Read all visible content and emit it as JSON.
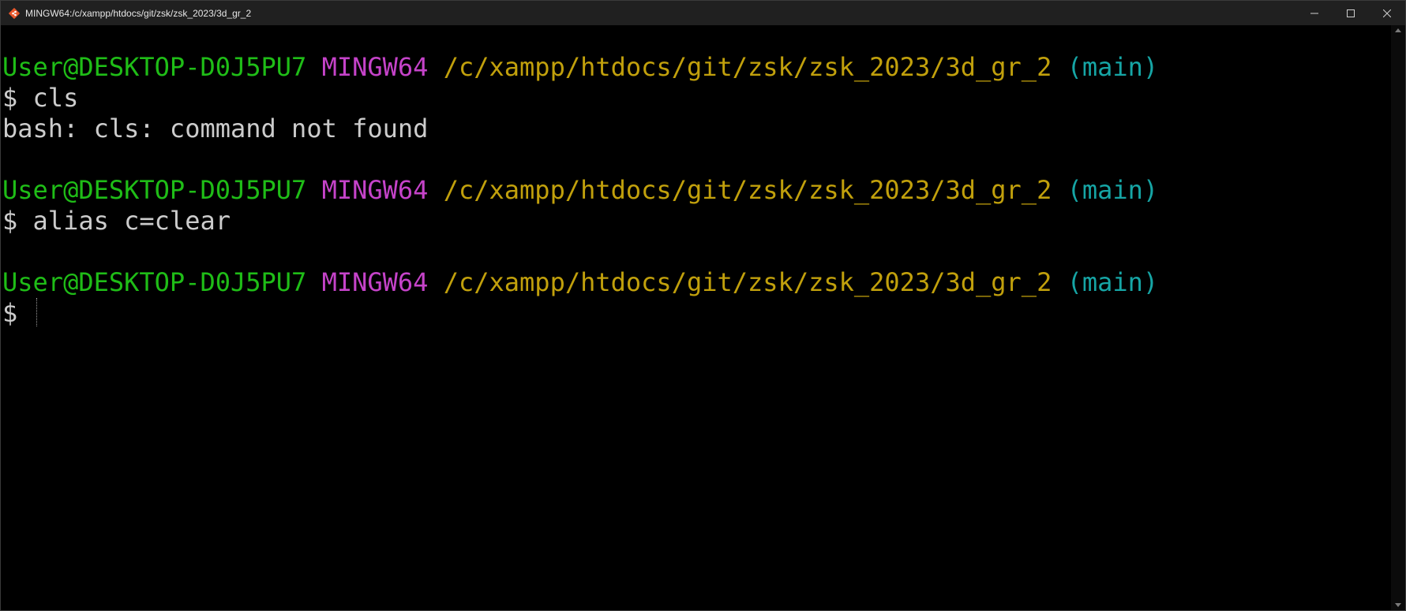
{
  "window": {
    "title": "MINGW64:/c/xampp/htdocs/git/zsk/zsk_2023/3d_gr_2",
    "icon": "git-bash-icon",
    "controls": [
      "minimize-icon",
      "maximize-icon",
      "close-icon"
    ]
  },
  "colors": {
    "user": "#1fbd17",
    "mingw": "#c543c9",
    "path": "#c1a00c",
    "branch": "#16a5a5",
    "text": "#cccccc",
    "background": "#000000"
  },
  "terminal": {
    "prompt1": {
      "user": "User@DESKTOP-D0J5PU7",
      "system": "MINGW64",
      "path": "/c/xampp/htdocs/git/zsk/zsk_2023/3d_gr_2",
      "branch": "(main)"
    },
    "command1": "$ cls",
    "output1": "bash: cls: command not found",
    "prompt2": {
      "user": "User@DESKTOP-D0J5PU7",
      "system": "MINGW64",
      "path": "/c/xampp/htdocs/git/zsk/zsk_2023/3d_gr_2",
      "branch": "(main)"
    },
    "command2": "$ alias c=clear",
    "prompt3": {
      "user": "User@DESKTOP-D0J5PU7",
      "system": "MINGW64",
      "path": "/c/xampp/htdocs/git/zsk/zsk_2023/3d_gr_2",
      "branch": "(main)"
    },
    "command3": "$ "
  }
}
